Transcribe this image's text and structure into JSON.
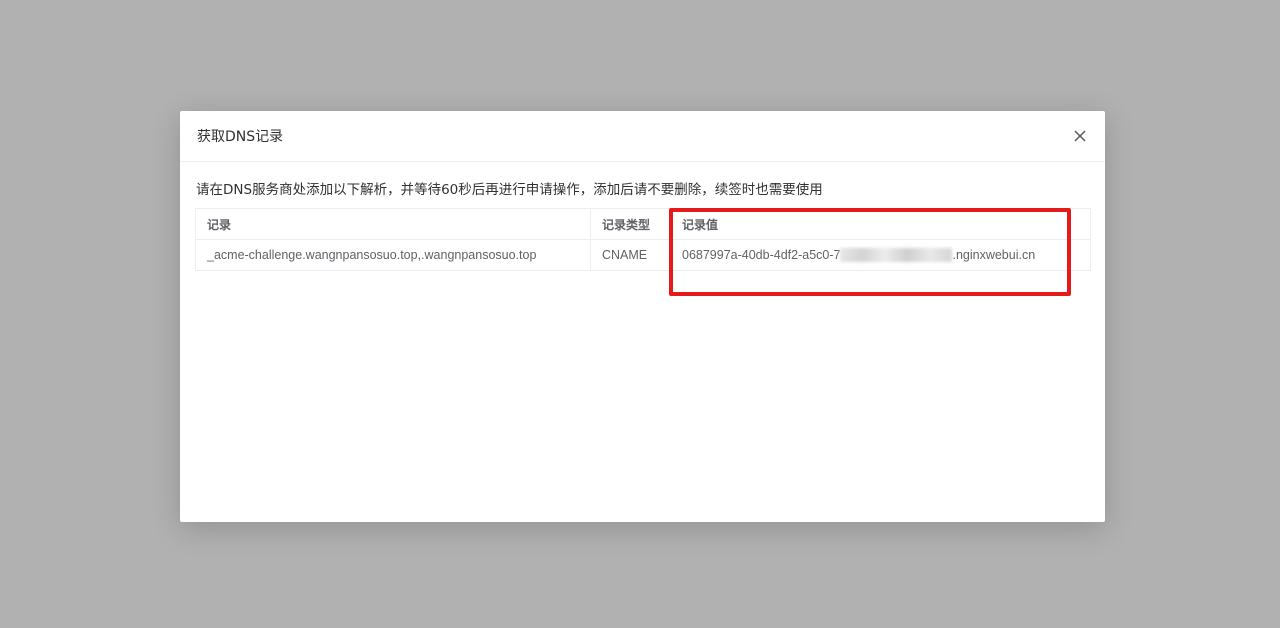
{
  "dialog": {
    "title": "获取DNS记录",
    "close_icon": "close-icon"
  },
  "instruction": "请在DNS服务商处添加以下解析，并等待60秒后再进行申请操作，添加后请不要删除，续签时也需要使用",
  "table": {
    "columns": [
      "记录",
      "记录类型",
      "记录值"
    ],
    "rows": [
      {
        "record": "_acme-challenge.wangnpansosuo.top,.wangnpansosuo.top",
        "type": "CNAME",
        "value_prefix": "0687997a-40db-4df2-a5c0-7",
        "value_suffix": ".nginxwebui.cn"
      }
    ]
  },
  "colors": {
    "overlay": "#b1b1b1",
    "highlight": "#e51b1b"
  }
}
